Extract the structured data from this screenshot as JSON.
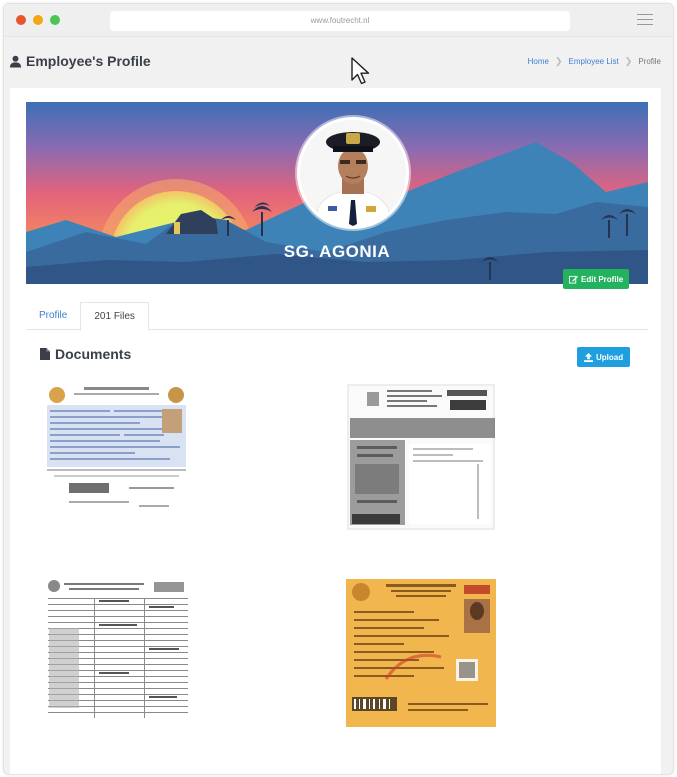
{
  "browser": {
    "url": "www.foutrecht.nl"
  },
  "header": {
    "title": "Employee's Profile",
    "breadcrumb": [
      {
        "label": "Home"
      },
      {
        "label": "Employee List"
      },
      {
        "label": "Profile"
      }
    ]
  },
  "profile": {
    "name": "SG. AGONIA",
    "edit_label": "Edit Profile"
  },
  "tabs": [
    {
      "label": "Profile",
      "state": "link"
    },
    {
      "label": "201 Files",
      "state": "selected"
    }
  ],
  "documents": {
    "title": "Documents",
    "upload_label": "Upload",
    "items": [
      {
        "name": "document-1",
        "tone": "white-blue"
      },
      {
        "name": "document-2",
        "tone": "grey"
      },
      {
        "name": "document-3",
        "tone": "white"
      },
      {
        "name": "document-4",
        "tone": "yellow"
      },
      {
        "name": "document-5",
        "tone": "blue"
      }
    ]
  },
  "colors": {
    "link": "#3f7fd6",
    "edit_button": "#23b35e",
    "upload_button": "#1f9fe0",
    "title_text": "#3a3f4a"
  }
}
